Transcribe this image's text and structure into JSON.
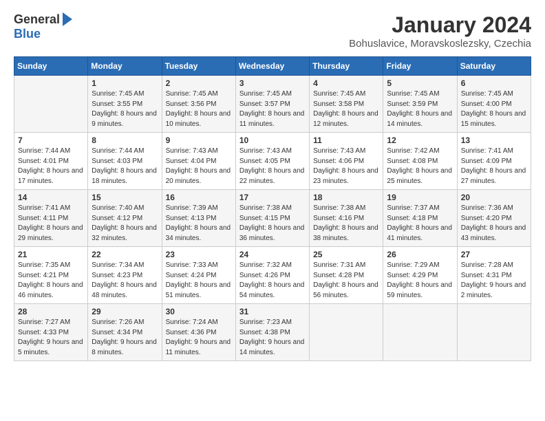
{
  "header": {
    "logo_general": "General",
    "logo_blue": "Blue",
    "month_title": "January 2024",
    "location": "Bohuslavice, Moravskoslezsky, Czechia"
  },
  "days_of_week": [
    "Sunday",
    "Monday",
    "Tuesday",
    "Wednesday",
    "Thursday",
    "Friday",
    "Saturday"
  ],
  "weeks": [
    [
      {
        "day": "",
        "info": ""
      },
      {
        "day": "1",
        "info": "Sunrise: 7:45 AM\nSunset: 3:55 PM\nDaylight: 8 hours\nand 9 minutes."
      },
      {
        "day": "2",
        "info": "Sunrise: 7:45 AM\nSunset: 3:56 PM\nDaylight: 8 hours\nand 10 minutes."
      },
      {
        "day": "3",
        "info": "Sunrise: 7:45 AM\nSunset: 3:57 PM\nDaylight: 8 hours\nand 11 minutes."
      },
      {
        "day": "4",
        "info": "Sunrise: 7:45 AM\nSunset: 3:58 PM\nDaylight: 8 hours\nand 12 minutes."
      },
      {
        "day": "5",
        "info": "Sunrise: 7:45 AM\nSunset: 3:59 PM\nDaylight: 8 hours\nand 14 minutes."
      },
      {
        "day": "6",
        "info": "Sunrise: 7:45 AM\nSunset: 4:00 PM\nDaylight: 8 hours\nand 15 minutes."
      }
    ],
    [
      {
        "day": "7",
        "info": "Sunrise: 7:44 AM\nSunset: 4:01 PM\nDaylight: 8 hours\nand 17 minutes."
      },
      {
        "day": "8",
        "info": "Sunrise: 7:44 AM\nSunset: 4:03 PM\nDaylight: 8 hours\nand 18 minutes."
      },
      {
        "day": "9",
        "info": "Sunrise: 7:43 AM\nSunset: 4:04 PM\nDaylight: 8 hours\nand 20 minutes."
      },
      {
        "day": "10",
        "info": "Sunrise: 7:43 AM\nSunset: 4:05 PM\nDaylight: 8 hours\nand 22 minutes."
      },
      {
        "day": "11",
        "info": "Sunrise: 7:43 AM\nSunset: 4:06 PM\nDaylight: 8 hours\nand 23 minutes."
      },
      {
        "day": "12",
        "info": "Sunrise: 7:42 AM\nSunset: 4:08 PM\nDaylight: 8 hours\nand 25 minutes."
      },
      {
        "day": "13",
        "info": "Sunrise: 7:41 AM\nSunset: 4:09 PM\nDaylight: 8 hours\nand 27 minutes."
      }
    ],
    [
      {
        "day": "14",
        "info": "Sunrise: 7:41 AM\nSunset: 4:11 PM\nDaylight: 8 hours\nand 29 minutes."
      },
      {
        "day": "15",
        "info": "Sunrise: 7:40 AM\nSunset: 4:12 PM\nDaylight: 8 hours\nand 32 minutes."
      },
      {
        "day": "16",
        "info": "Sunrise: 7:39 AM\nSunset: 4:13 PM\nDaylight: 8 hours\nand 34 minutes."
      },
      {
        "day": "17",
        "info": "Sunrise: 7:38 AM\nSunset: 4:15 PM\nDaylight: 8 hours\nand 36 minutes."
      },
      {
        "day": "18",
        "info": "Sunrise: 7:38 AM\nSunset: 4:16 PM\nDaylight: 8 hours\nand 38 minutes."
      },
      {
        "day": "19",
        "info": "Sunrise: 7:37 AM\nSunset: 4:18 PM\nDaylight: 8 hours\nand 41 minutes."
      },
      {
        "day": "20",
        "info": "Sunrise: 7:36 AM\nSunset: 4:20 PM\nDaylight: 8 hours\nand 43 minutes."
      }
    ],
    [
      {
        "day": "21",
        "info": "Sunrise: 7:35 AM\nSunset: 4:21 PM\nDaylight: 8 hours\nand 46 minutes."
      },
      {
        "day": "22",
        "info": "Sunrise: 7:34 AM\nSunset: 4:23 PM\nDaylight: 8 hours\nand 48 minutes."
      },
      {
        "day": "23",
        "info": "Sunrise: 7:33 AM\nSunset: 4:24 PM\nDaylight: 8 hours\nand 51 minutes."
      },
      {
        "day": "24",
        "info": "Sunrise: 7:32 AM\nSunset: 4:26 PM\nDaylight: 8 hours\nand 54 minutes."
      },
      {
        "day": "25",
        "info": "Sunrise: 7:31 AM\nSunset: 4:28 PM\nDaylight: 8 hours\nand 56 minutes."
      },
      {
        "day": "26",
        "info": "Sunrise: 7:29 AM\nSunset: 4:29 PM\nDaylight: 8 hours\nand 59 minutes."
      },
      {
        "day": "27",
        "info": "Sunrise: 7:28 AM\nSunset: 4:31 PM\nDaylight: 9 hours\nand 2 minutes."
      }
    ],
    [
      {
        "day": "28",
        "info": "Sunrise: 7:27 AM\nSunset: 4:33 PM\nDaylight: 9 hours\nand 5 minutes."
      },
      {
        "day": "29",
        "info": "Sunrise: 7:26 AM\nSunset: 4:34 PM\nDaylight: 9 hours\nand 8 minutes."
      },
      {
        "day": "30",
        "info": "Sunrise: 7:24 AM\nSunset: 4:36 PM\nDaylight: 9 hours\nand 11 minutes."
      },
      {
        "day": "31",
        "info": "Sunrise: 7:23 AM\nSunset: 4:38 PM\nDaylight: 9 hours\nand 14 minutes."
      },
      {
        "day": "",
        "info": ""
      },
      {
        "day": "",
        "info": ""
      },
      {
        "day": "",
        "info": ""
      }
    ]
  ]
}
